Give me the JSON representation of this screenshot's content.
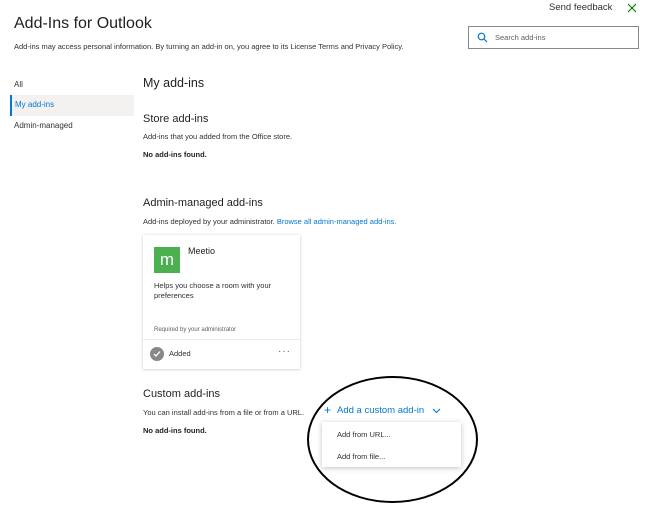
{
  "header": {
    "title": "Add-Ins for Outlook",
    "description": "Add-ins may access personal information. By turning an add-in on, you agree to its License Terms and Privacy Policy.",
    "send_feedback": "Send feedback",
    "close_icon": "close-icon",
    "accent_color": "#107c10"
  },
  "search": {
    "placeholder": "Search add-ins",
    "value": "",
    "icon": "search-icon"
  },
  "sidebar": {
    "items": [
      {
        "label": "All",
        "selected": false
      },
      {
        "label": "My add-ins",
        "selected": true
      },
      {
        "label": "Admin-managed",
        "selected": false
      }
    ],
    "accent_color": "#0078d4"
  },
  "main": {
    "title": "My add-ins",
    "store": {
      "heading": "Store add-ins",
      "description": "Add-ins that you added from the Office store.",
      "empty": "No add-ins found."
    },
    "admin": {
      "heading": "Admin-managed add-ins",
      "description": "Add-ins deployed by your administrator.",
      "link": "Browse all admin-managed add-ins.",
      "cards": [
        {
          "logo_letter": "m",
          "name": "Meetio",
          "description": "Helps you choose a room with your preferences",
          "required": "Required by your administrator",
          "status": "Added",
          "more": "···",
          "logo_color": "#4caf50"
        }
      ]
    },
    "custom": {
      "heading": "Custom add-ins",
      "description": "You can install add-ins from a file or from a URL.",
      "empty": "No add-ins found.",
      "add_button": "Add a custom add-in",
      "menu": [
        "Add from URL...",
        "Add from file..."
      ]
    }
  }
}
